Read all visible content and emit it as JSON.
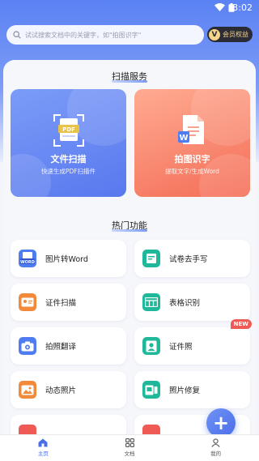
{
  "status_bar": {
    "time": "3:02"
  },
  "search": {
    "placeholder": "试试搜索文档中的关键字，如\"拍图识字\"",
    "icon": "search-icon"
  },
  "vip": {
    "badge": "V",
    "label": "会员权益"
  },
  "scan_section": {
    "title": "扫描服务",
    "cards": [
      {
        "title": "文件扫描",
        "subtitle": "快速生成PDF扫描件",
        "icon": "pdf-scan-icon",
        "icon_text": "PDF"
      },
      {
        "title": "拍图识字",
        "subtitle": "提取文字/生成Word",
        "icon": "word-doc-icon",
        "icon_text": "W"
      }
    ]
  },
  "hot_section": {
    "title": "热门功能",
    "items": [
      {
        "label": "图片转Word",
        "icon": "image-to-word-icon",
        "icon_text": "WORD",
        "color": "#4f7cf0"
      },
      {
        "label": "试卷去手写",
        "icon": "exam-paper-icon",
        "color": "#1fb89a"
      },
      {
        "label": "证件扫描",
        "icon": "id-card-icon",
        "color": "#f28a3c"
      },
      {
        "label": "表格识别",
        "icon": "table-icon",
        "color": "#1fb89a"
      },
      {
        "label": "拍照翻译",
        "icon": "camera-translate-icon",
        "color": "#4f7cf0"
      },
      {
        "label": "证件照",
        "icon": "id-photo-icon",
        "color": "#1fb89a",
        "tag": "NEW"
      },
      {
        "label": "动态照片",
        "icon": "live-photo-icon",
        "color": "#f28a3c"
      },
      {
        "label": "照片修复",
        "icon": "photo-repair-icon",
        "color": "#1fb89a"
      }
    ]
  },
  "fab": {
    "label": "+"
  },
  "tab_bar": {
    "tabs": [
      {
        "label": "主页",
        "icon": "home-icon",
        "active": true
      },
      {
        "label": "文档",
        "icon": "grid-icon",
        "active": false
      },
      {
        "label": "我的",
        "icon": "user-icon",
        "active": false
      }
    ]
  },
  "colors": {
    "primary": "#4a6ee8",
    "accent_red": "#f46d56",
    "new_tag": "#f05a55"
  }
}
